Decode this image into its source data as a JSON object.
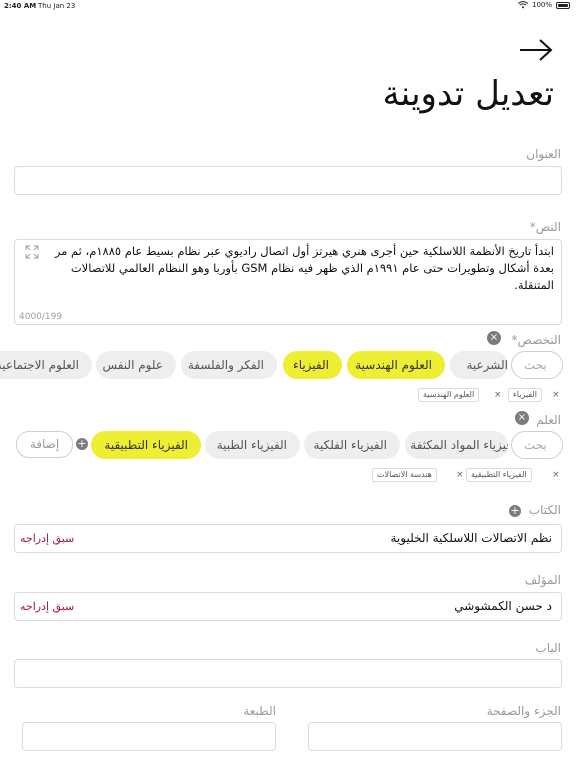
{
  "status_bar": {
    "time": "2:40 AM",
    "date": "Thu Jan 23",
    "battery": "100%"
  },
  "page_title": "تعديل تدوينة",
  "title_field": {
    "label": "العنوان",
    "value": ""
  },
  "text_field": {
    "label": "النص*",
    "value": "ابتدأ تاريخ الأنظمة اللاسلكية حين أجرى هنري هيرتز أول اتصال راديوي عبر نظام بسيط عام ١٨٨٥م، ثم مر بعدة أشكال وتطويرات حتى عام ١٩٩١م الذي ظهر فيه نظام GSM بأوربا وهو النظام العالمي للاتصالات المتنقلة.",
    "counter": "4000/199"
  },
  "specialization": {
    "label": "التخصص*",
    "search_placeholder": "بحث",
    "chips": [
      "الشرعية",
      "العلوم الهندسية",
      "الفيزياء",
      "الفكر والفلسفة",
      "علوم النفس",
      "العلوم الاجتماعية"
    ],
    "selected_tags": [
      "الفيزياء",
      "العلوم الهندسية"
    ]
  },
  "science": {
    "label": "العلم",
    "search_placeholder": "بحث",
    "chips": [
      "فيزياء المواد المكثفة",
      "الفيزياء الفلكية",
      "الفيزياء الطبية",
      "الفيزياء التطبيقية"
    ],
    "add_label": "إضافة",
    "selected_tags": [
      "الفيزياء التطبيقية",
      "هندسة الاتصالات"
    ]
  },
  "book": {
    "label": "الكتاب",
    "value": "نظم الاتصالات اللاسلكية الخليوية",
    "prev_link": "سبق إدراجه"
  },
  "author": {
    "label": "المؤلف",
    "value": "د  حسن الكمشوشي",
    "prev_link": "سبق إدراجه"
  },
  "chapter": {
    "label": "الباب",
    "value": ""
  },
  "part_page": {
    "label": "الجزء والصفحة",
    "value": ""
  },
  "edition": {
    "label": "الطبعة",
    "value": ""
  },
  "colors": {
    "accent_yellow": "#eeee33",
    "link_red": "#a21a3a"
  }
}
